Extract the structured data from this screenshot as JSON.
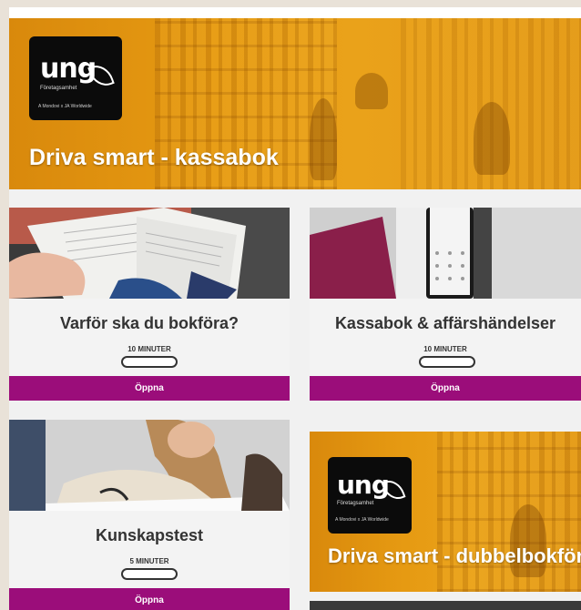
{
  "courses": [
    {
      "logo": {
        "wordmark": "ung",
        "tagline": "Företagsamhet",
        "subline": "A Mondovi x JA Worldwide"
      },
      "title": "Driva smart - kassabok",
      "modules": [
        {
          "title": "Varför ska du bokföra?",
          "duration": "10 MINUTER",
          "progress": 0,
          "open_label": "Öppna"
        },
        {
          "title": "Kassabok & affärshändelser",
          "duration": "10 MINUTER",
          "progress": 0,
          "open_label": "Öppna"
        },
        {
          "title": "Kunskapstest",
          "duration": "5 MINUTER",
          "progress": 0,
          "open_label": "Öppna"
        }
      ]
    },
    {
      "logo": {
        "wordmark": "ung",
        "tagline": "Företagsamhet",
        "subline": "A Mondovi x JA Worldwide"
      },
      "title": "Driva smart - dubbelbokföring"
    }
  ],
  "colors": {
    "hero": "#e69a12",
    "open_button": "#9b0d7a",
    "page_bg": "#e9e2d8",
    "card_bg": "#f3f3f3"
  }
}
